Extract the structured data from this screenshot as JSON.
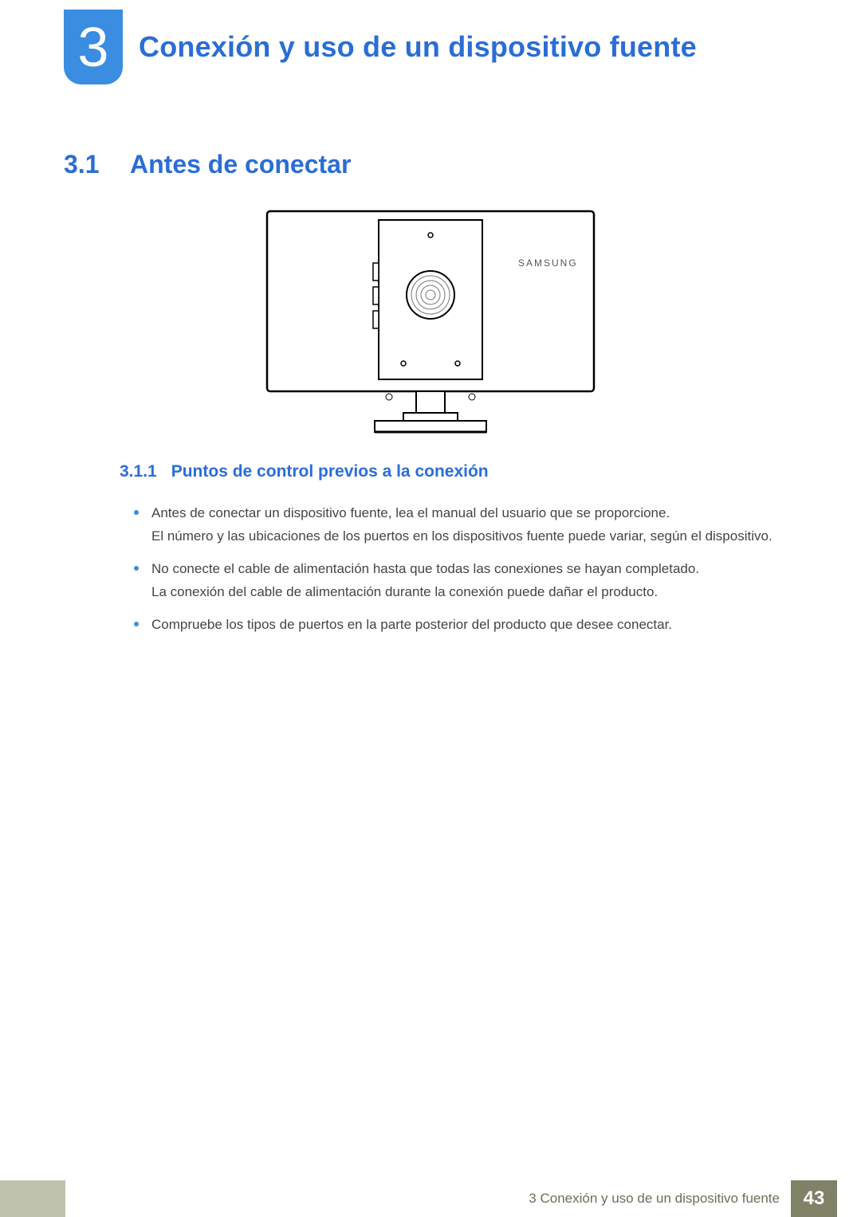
{
  "chapter": {
    "number": "3",
    "title": "Conexión y uso de un dispositivo fuente"
  },
  "section": {
    "number": "3.1",
    "title": "Antes de conectar"
  },
  "figure": {
    "brand": "SAMSUNG"
  },
  "subsection": {
    "number": "3.1.1",
    "title": "Puntos de control previos a la conexión"
  },
  "bullets": [
    {
      "line1": "Antes de conectar un dispositivo fuente, lea el manual del usuario que se proporcione.",
      "line2": "El número y las ubicaciones de los puertos en los dispositivos fuente puede variar, según el dispositivo."
    },
    {
      "line1": "No conecte el cable de alimentación hasta que todas las conexiones se hayan completado.",
      "line2": "La conexión del cable de alimentación durante la conexión puede dañar el producto."
    },
    {
      "line1": "Compruebe los tipos de puertos en la parte posterior del producto que desee conectar.",
      "line2": ""
    }
  ],
  "footer": {
    "breadcrumb": "3 Conexión y uso de un dispositivo fuente",
    "page": "43"
  }
}
